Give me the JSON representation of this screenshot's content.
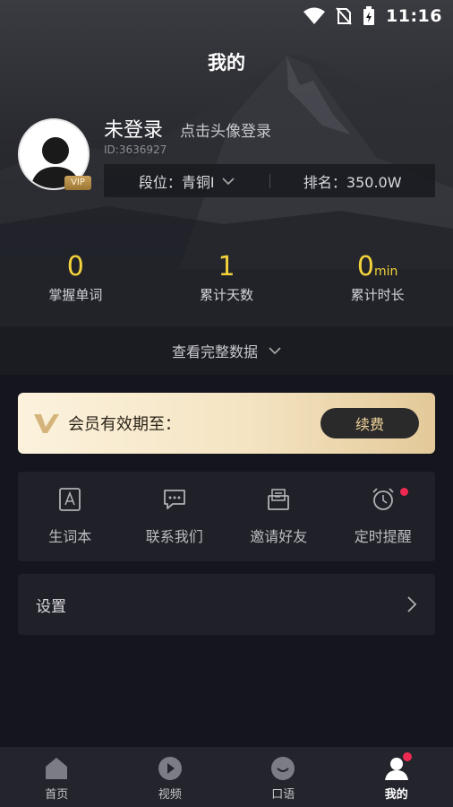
{
  "status_bar": {
    "time": "11:16",
    "icons": [
      "wifi-icon",
      "no-sim-icon",
      "battery-charging-icon"
    ]
  },
  "header": {
    "title": "我的"
  },
  "profile": {
    "name": "未登录",
    "login_hint": "点击头像登录",
    "user_id": "ID:3636927",
    "vip_badge": "VIP",
    "level_label": "段位：青铜I",
    "rank_label": "排名：350.0W"
  },
  "stats": [
    {
      "value": "0",
      "unit": "",
      "label": "掌握单词"
    },
    {
      "value": "1",
      "unit": "",
      "label": "累计天数"
    },
    {
      "value": "0",
      "unit": "min",
      "label": "累计时长"
    }
  ],
  "full_data": {
    "label": "查看完整数据"
  },
  "membership": {
    "text": "会员有效期至：",
    "renew_label": "续费",
    "accent": "#f1d49b"
  },
  "tools": [
    {
      "icon": "vocabulary-book-icon",
      "label": "生词本"
    },
    {
      "icon": "chat-bubble-icon",
      "label": "联系我们"
    },
    {
      "icon": "invite-envelope-icon",
      "label": "邀请好友"
    },
    {
      "icon": "alarm-clock-icon",
      "label": "定时提醒"
    }
  ],
  "settings": {
    "label": "设置"
  },
  "tabbar": [
    {
      "icon": "home-icon",
      "label": "首页"
    },
    {
      "icon": "video-play-icon",
      "label": "视频"
    },
    {
      "icon": "speech-icon",
      "label": "口语"
    },
    {
      "icon": "profile-icon",
      "label": "我的"
    }
  ],
  "colors": {
    "stat_yellow": "#f3d23a",
    "badge_red": "#ef2a52"
  }
}
